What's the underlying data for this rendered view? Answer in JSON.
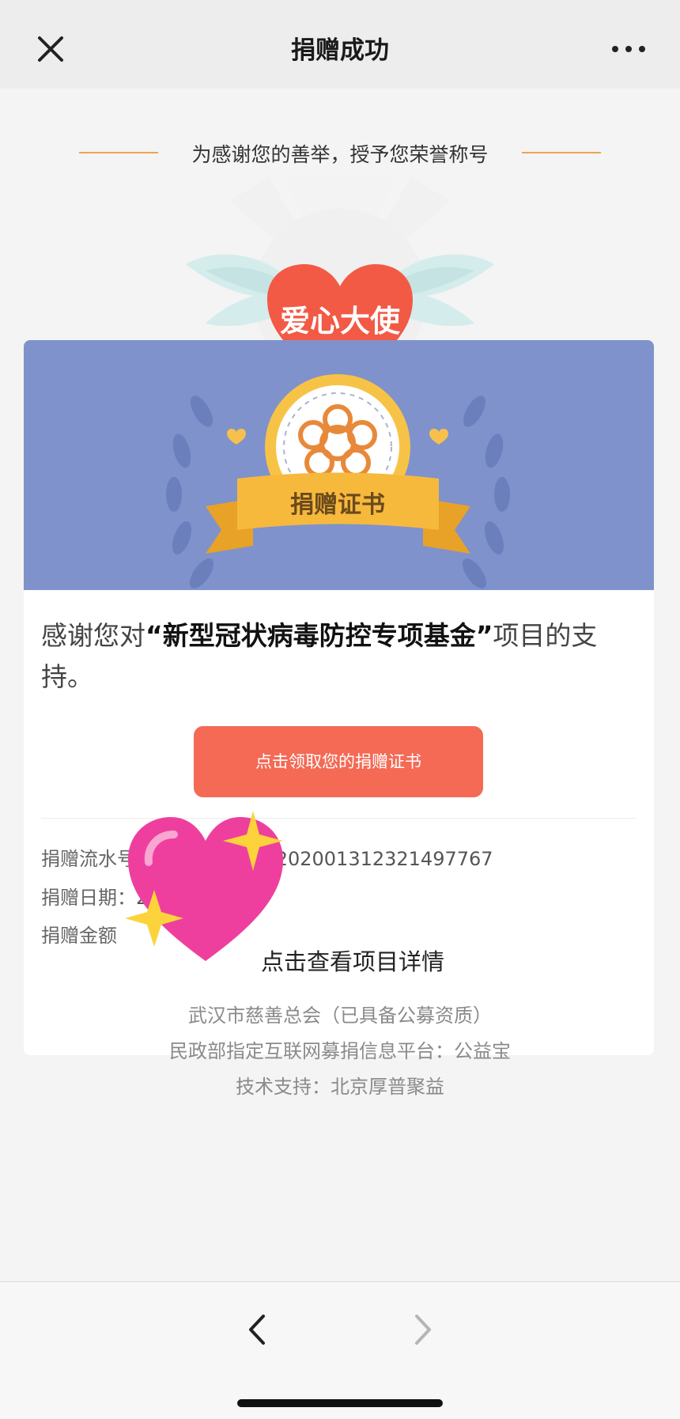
{
  "nav": {
    "title": "捐赠成功"
  },
  "honor": {
    "caption": "为感谢您的善举，授予您荣誉称号",
    "badge_label": "爱心大使"
  },
  "certificate": {
    "banner_label": "捐赠证书",
    "thanks_prefix": "感谢您对",
    "project_name": "“新型冠状病毒防控专项基金”",
    "thanks_suffix": "项目的支持。",
    "button_label": "点击领取您的捐赠证书",
    "serial_label": "捐赠流水号：",
    "serial_value": "4200000509202001312321497767",
    "date_label": "捐赠日期：",
    "date_value": "2020-01-31",
    "amount_label": "捐赠金额",
    "detail_link": "点击查看项目详情"
  },
  "footer": {
    "line1": "武汉市慈善总会（已具备公募资质）",
    "line2": "民政部指定互联网募捐信息平台：公益宝",
    "line3": "技术支持：北京厚普聚益"
  },
  "colors": {
    "accent_button": "#f46a55",
    "banner_blue": "#7f92cb",
    "heart_red": "#f25a46",
    "ribbon_gold": "#f6b93c"
  }
}
